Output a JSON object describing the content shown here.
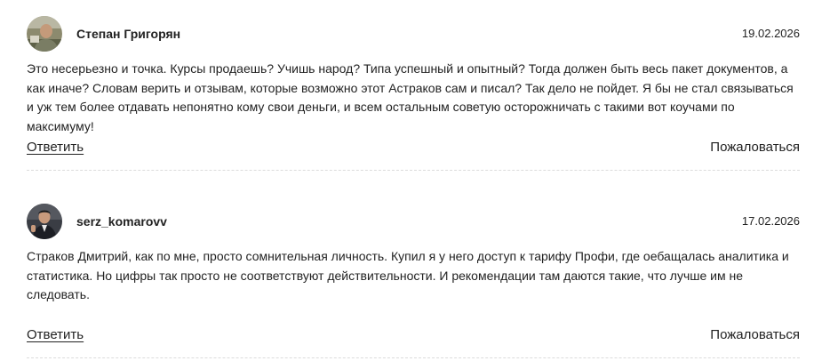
{
  "comments": [
    {
      "author": "Степан Григорян",
      "date": "19.02.2026",
      "text": "Это несерьезно и точка. Курсы продаешь? Учишь народ? Типа успешный и опытный? Тогда должен быть весь пакет документов, а как иначе? Словам верить и отзывам, которые возможно этот Астраков сам и писал? Так дело не пойдет. Я бы не стал связываться и уж тем более отдавать непонятно кому свои деньги, и всем остальным советую осторожничать с такими вот коучами по максимуму!",
      "reply_label": "Ответить",
      "report_label": "Пожаловаться"
    },
    {
      "author": "serz_komarovv",
      "date": "17.02.2026",
      "text": "Страков Дмитрий, как по мне, просто сомнительная личность. Купил я у него доступ к тарифу Профи, где оебащалась аналитика и статистика. Но цифры так просто не соответствуют действительности. И рекомендации там даются такие, что лучше им не следовать.",
      "reply_label": "Ответить",
      "report_label": "Пожаловаться"
    }
  ]
}
